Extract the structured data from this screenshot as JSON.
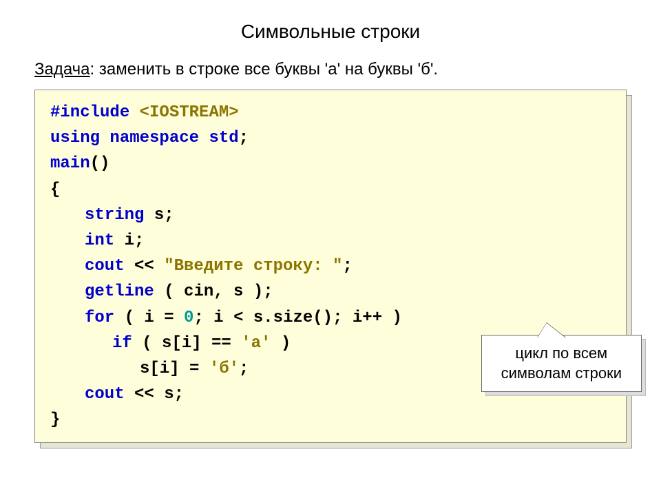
{
  "title": "Символьные строки",
  "task": {
    "label": "Задача",
    "text": ": заменить в строке все буквы 'а' на буквы 'б'."
  },
  "code": {
    "include_kw": "#include",
    "include_hdr": "<IOSTREAM>",
    "using_kw": "using",
    "namespace_kw": "namespace",
    "std_kw": "std",
    "semicolon": ";",
    "main_kw": "main",
    "parens": "()",
    "lbrace": "{",
    "rbrace": "}",
    "string_kw": "string",
    "var_s": " s;",
    "int_kw": "int",
    "var_i": " i;",
    "cout_kw": "cout",
    "lshift": " << ",
    "prompt_str": "\"Введите строку: \"",
    "getline_kw": "getline",
    "getline_args": " ( cin, s );",
    "for_kw": "for",
    "for_open": " ( i = ",
    "zero": "0",
    "for_mid": "; i < s.size(); i++ )",
    "if_kw": "if",
    "if_open": " ( s[i] == ",
    "char_a": "'а'",
    "if_close": " )",
    "assign_left": "s[i] = ",
    "char_b": "'б'",
    "assign_end": ";",
    "cout_s": " << s;"
  },
  "callout": {
    "line1": "цикл по всем",
    "line2": "символам строки"
  }
}
